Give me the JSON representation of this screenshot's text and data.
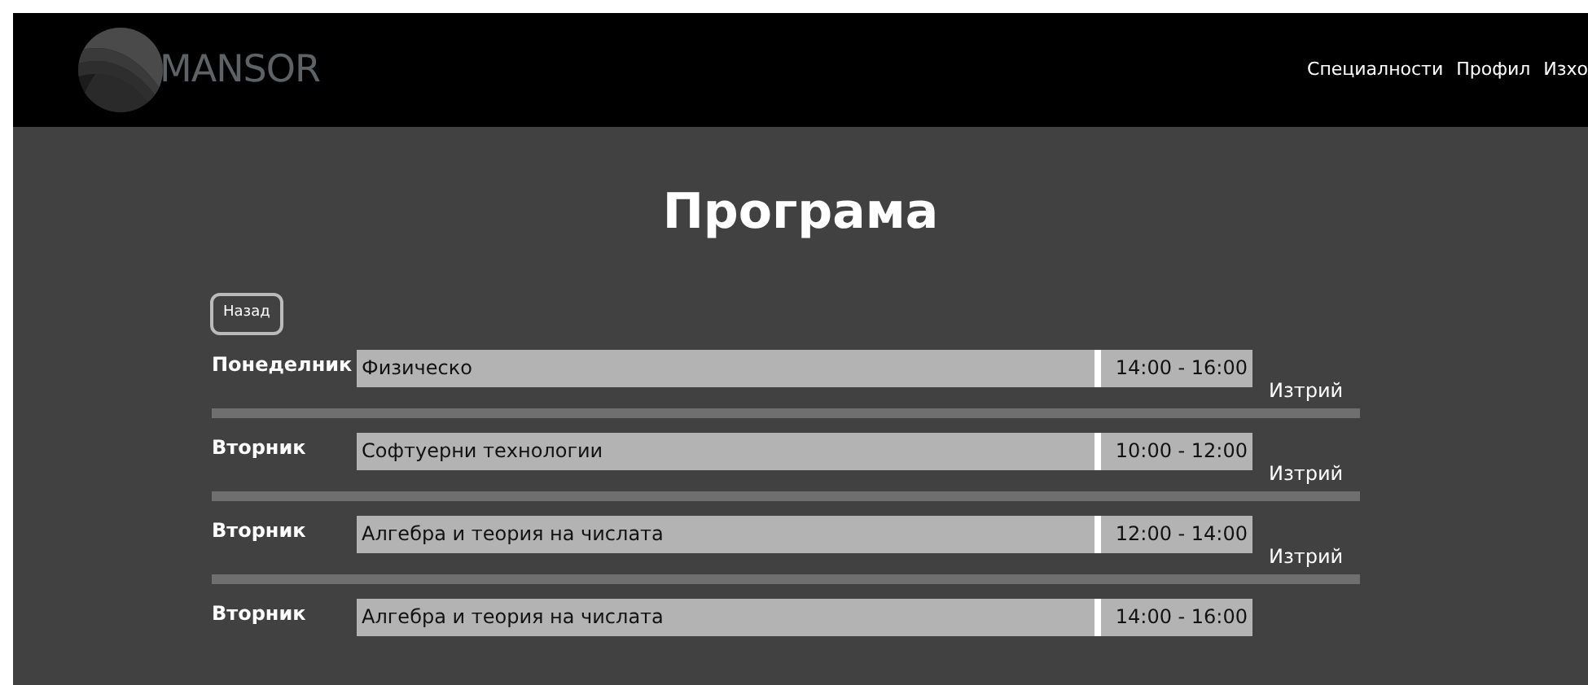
{
  "header": {
    "logo_text": "MANSOR",
    "nav": [
      "Специалности",
      "Профил",
      "Изхо"
    ]
  },
  "title": "Програма",
  "back_button": "Назад",
  "schedule": [
    {
      "day": "Понеделник",
      "subject": "Физическо",
      "time": "14:00 - 16:00",
      "delete": "Изтрий"
    },
    {
      "day": "Вторник",
      "subject": "Софтуерни технологии",
      "time": "10:00 - 12:00",
      "delete": "Изтрий"
    },
    {
      "day": "Вторник",
      "subject": "Алгебра и теория на числата",
      "time": "12:00 - 14:00",
      "delete": "Изтрий"
    },
    {
      "day": "Вторник",
      "subject": "Алгебра и теория на числата",
      "time": "14:00 - 16:00"
    }
  ]
}
